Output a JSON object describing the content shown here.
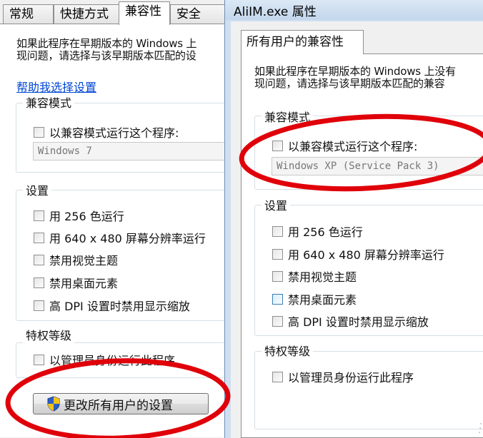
{
  "left_window": {
    "tabs": [
      "常规",
      "快捷方式",
      "兼容性",
      "安全"
    ],
    "description_line1": "如果此程序在早期版本的 Windows 上",
    "description_line2": "现问题，请选择与该早期版本匹配的设",
    "help_link": "帮助我选择设置",
    "compat_group": {
      "title": "兼容模式",
      "checkbox_label": "以兼容模式运行这个程序:",
      "os_value": "Windows 7"
    },
    "settings_group": {
      "title": "设置",
      "items": [
        "用 256 色运行",
        "用 640 x 480 屏幕分辨率运行",
        "禁用视觉主题",
        "禁用桌面元素",
        "高 DPI 设置时禁用显示缩放"
      ]
    },
    "privilege_group": {
      "title": "特权等级",
      "checkbox_label": "以管理员身份运行此程序"
    },
    "change_all_users_button": "更改所有用户的设置"
  },
  "right_window": {
    "title": "AliIM.exe 属性",
    "tab": "所有用户的兼容性",
    "description_line1": "如果此程序在早期版本的 Windows 上没有",
    "description_line2": "现问题，请选择与该早期版本匹配的兼容",
    "compat_group": {
      "title": "兼容模式",
      "checkbox_label": "以兼容模式运行这个程序:",
      "os_value": "Windows XP (Service Pack 3)"
    },
    "settings_group": {
      "title": "设置",
      "items": [
        "用 256 色运行",
        "用 640 x 480 屏幕分辨率运行",
        "禁用视觉主题",
        "禁用桌面元素",
        "高 DPI 设置时禁用显示缩放"
      ]
    },
    "privilege_group": {
      "title": "特权等级",
      "checkbox_label": "以管理员身份运行此程序"
    }
  },
  "colors": {
    "annotation_red": "#e0000a",
    "link_blue": "#0046d5"
  },
  "icons": {
    "button_icon": "uac-shield-icon",
    "resize_grip": "resize-grip-icon"
  }
}
